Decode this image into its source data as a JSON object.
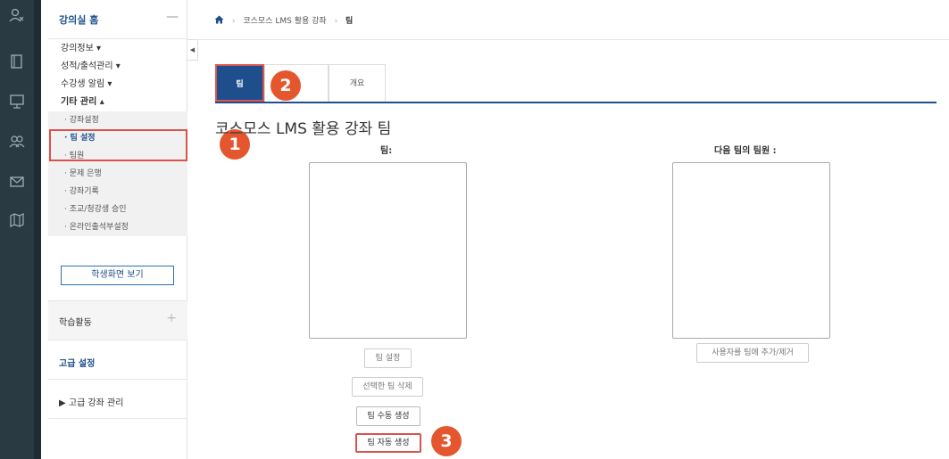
{
  "rail": {
    "icons": [
      "user-cross-icon",
      "book-icon",
      "whiteboard-icon",
      "users-icon",
      "mail-icon",
      "map-icon"
    ]
  },
  "sidebar": {
    "header_title": "강의실 홈",
    "header_toggle": "—",
    "menu": [
      {
        "label": "강의정보 ▾"
      },
      {
        "label": "성적/출석관리 ▾"
      },
      {
        "label": "수강생 알림 ▾"
      },
      {
        "label": "기타 관리 ▴"
      }
    ],
    "submenu": [
      {
        "label": "· 강좌설정"
      },
      {
        "label": "· 팀 설정"
      },
      {
        "label": "· 팀원"
      },
      {
        "label": "· 문제 은행"
      },
      {
        "label": "· 강좌기록"
      },
      {
        "label": "· 조교/청강생 승인"
      },
      {
        "label": "· 온라인출석부설정"
      }
    ],
    "student_view_button": "학생화면 보기",
    "learning_activity": "학습활동",
    "learning_activity_plus": "+",
    "advanced_settings": "고급 설정",
    "advanced_course_mgmt": "▶  고급 강좌 관리"
  },
  "breadcrumb": {
    "home_icon": "home-icon",
    "sep": "›",
    "course": "코스모스 LMS 활용 강좌",
    "current": "팀"
  },
  "tabs": {
    "team": "팀",
    "overview": "개요"
  },
  "badges": {
    "one": "1",
    "two": "2",
    "three": "3"
  },
  "main": {
    "title": "코스모스 LMS 활용 강좌 팀",
    "teams_label": "팀:",
    "members_label": "다음 팀의 팀원 :",
    "btn_team_settings": "팀 설정",
    "btn_delete_selected": "선택한 팀 삭제",
    "btn_create_manual": "팀 수동 생성",
    "btn_create_auto": "팀 자동 생성",
    "btn_add_remove_users": "사용자를 팀에 추가/제거"
  },
  "colors": {
    "accent": "#1e4f8c",
    "highlight": "#d9534f",
    "badge": "#e4572e",
    "rail": "#2a3a42"
  }
}
